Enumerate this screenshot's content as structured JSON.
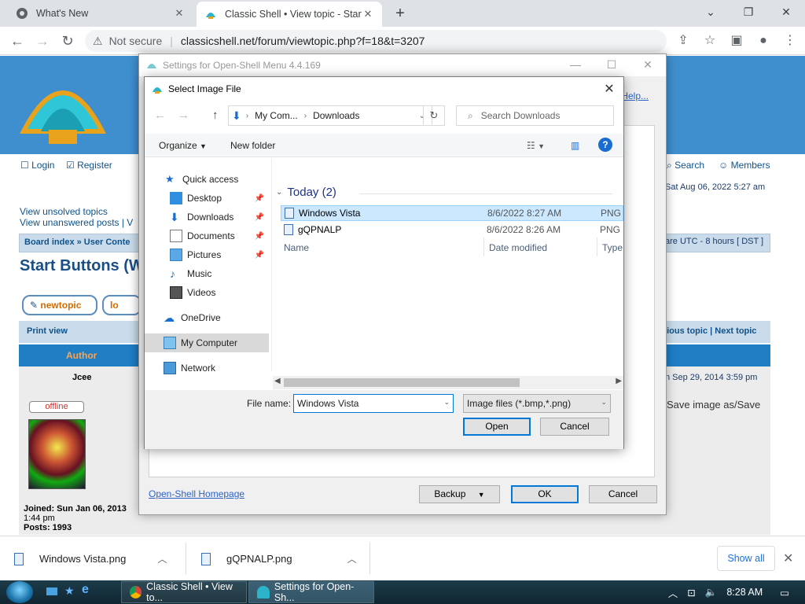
{
  "browser": {
    "tabs": [
      {
        "title": "What's New",
        "active": false
      },
      {
        "title": "Classic Shell • View topic - Start",
        "active": true
      }
    ],
    "new_tab": "+",
    "window_controls": {
      "minimize": "⌄",
      "restore": "❐",
      "close": "✕"
    },
    "address": {
      "security_label": "Not secure",
      "url": "classicshell.net/forum/viewtopic.php?f=18&t=3207"
    }
  },
  "forum": {
    "login": "Login",
    "register": "Register",
    "search": "Search",
    "members": "Members",
    "date_now": "Sat Aug 06, 2022 5:27 am",
    "unsolved": "View unsolved topics",
    "unanswered": "View unanswered posts | V",
    "board_index": "Board index » User Conte",
    "timezone": "are UTC - 8 hours [ DST ]",
    "topic_title": "Start Buttons (W",
    "new_topic": "newtopic",
    "lock_partial": "lo",
    "print_view": "Print view",
    "prev_next": "vious topic | Next topic",
    "author_header": "Author",
    "author_name": "Jcee",
    "post_date": "n Sep 29, 2014 3:59 pm",
    "offline": "offline",
    "save_image": "Save image as/Save",
    "joined": "Joined: Sun Jan 06, 2013",
    "joined_time": "1:44 pm",
    "posts": "Posts: 1993"
  },
  "settings": {
    "title": "Settings for Open-Shell Menu 4.4.169",
    "help": "Help...",
    "homepage": "Open-Shell Homepage",
    "backup": "Backup",
    "ok": "OK",
    "cancel": "Cancel"
  },
  "dialog": {
    "title": "Select Image File",
    "breadcrumb": [
      "My Com...",
      "Downloads"
    ],
    "search_placeholder": "Search Downloads",
    "organize": "Organize",
    "new_folder": "New folder",
    "nav": [
      {
        "label": "Quick access",
        "icon": "star-icon"
      },
      {
        "label": "Desktop",
        "icon": "desktop-icon",
        "pinned": true
      },
      {
        "label": "Downloads",
        "icon": "download-icon",
        "pinned": true
      },
      {
        "label": "Documents",
        "icon": "documents-icon",
        "pinned": true
      },
      {
        "label": "Pictures",
        "icon": "pictures-icon",
        "pinned": true
      },
      {
        "label": "Music",
        "icon": "music-icon"
      },
      {
        "label": "Videos",
        "icon": "videos-icon"
      },
      {
        "label": "OneDrive",
        "icon": "cloud-icon"
      },
      {
        "label": "My Computer",
        "icon": "computer-icon"
      },
      {
        "label": "Network",
        "icon": "network-icon"
      }
    ],
    "columns": {
      "name": "Name",
      "date": "Date modified",
      "type": "Type"
    },
    "group": "Today (2)",
    "files": [
      {
        "name": "Windows Vista",
        "date": "8/6/2022 8:27 AM",
        "type": "PNG",
        "selected": true
      },
      {
        "name": "gQPNALP",
        "date": "8/6/2022 8:26 AM",
        "type": "PNG",
        "selected": false
      }
    ],
    "file_name_label": "File name:",
    "file_name_value": "Windows Vista",
    "file_type": "Image files (*.bmp,*.png)",
    "open": "Open",
    "cancel": "Cancel"
  },
  "downloads": [
    {
      "name": "Windows Vista.png"
    },
    {
      "name": "gQPNALP.png"
    }
  ],
  "show_all": "Show all",
  "taskbar": {
    "tasks": [
      {
        "label": "Classic Shell • View to...",
        "active": false
      },
      {
        "label": "Settings for Open-Sh...",
        "active": true
      }
    ],
    "clock": "8:28 AM"
  },
  "colors": {
    "forum_header": "#3f8fcf",
    "selection": "#cce8ff",
    "accent": "#0078d7",
    "link": "#2d63c8"
  }
}
